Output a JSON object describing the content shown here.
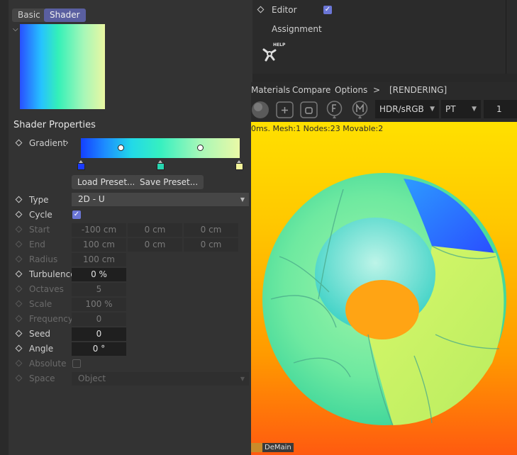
{
  "tabs": {
    "basic": "Basic",
    "shader": "Shader"
  },
  "shader": {
    "section_title": "Shader Properties",
    "gradient": {
      "label": "Gradient",
      "load_preset": "Load Preset...",
      "save_preset": "Save Preset...",
      "stop_colors": [
        "#1a3bff",
        "#27d6b0",
        "#f4f59a"
      ]
    },
    "type": {
      "label": "Type",
      "value": "2D - U"
    },
    "cycle": {
      "label": "Cycle",
      "checked": true
    },
    "start": {
      "label": "Start",
      "x": "-100 cm",
      "y": "0 cm",
      "z": "0 cm"
    },
    "end": {
      "label": "End",
      "x": "100 cm",
      "y": "0 cm",
      "z": "0 cm"
    },
    "radius": {
      "label": "Radius",
      "value": "100 cm"
    },
    "turbulence": {
      "label": "Turbulence",
      "value": "0 %"
    },
    "octaves": {
      "label": "Octaves",
      "value": "5"
    },
    "scale": {
      "label": "Scale",
      "value": "100 %"
    },
    "frequency": {
      "label": "Frequency",
      "value": "0"
    },
    "seed": {
      "label": "Seed",
      "value": "0"
    },
    "angle": {
      "label": "Angle",
      "value": "0 °"
    },
    "absolute": {
      "label": "Absolute",
      "checked": false
    },
    "space": {
      "label": "Space",
      "value": "Object"
    }
  },
  "object_panel": {
    "editor_label": "Editor",
    "editor_checked": true,
    "assignment_label": "Assignment",
    "help_text": "HELP"
  },
  "viewer": {
    "menu": [
      "Materials",
      "Compare",
      "Options",
      ">",
      "[RENDERING]"
    ],
    "toolbar": {
      "color_space": "HDR/sRGB",
      "kernel": "PT",
      "value": "1"
    },
    "stats": "0ms. Mesh:1 Nodes:23 Movable:2",
    "bottom_tag": "DeMain"
  },
  "colors": {
    "accent": "#5a5fa0",
    "checkbox": "#6b76d6",
    "render_bg_top": "#ffe000",
    "render_bg_bottom": "#ff5a10"
  }
}
